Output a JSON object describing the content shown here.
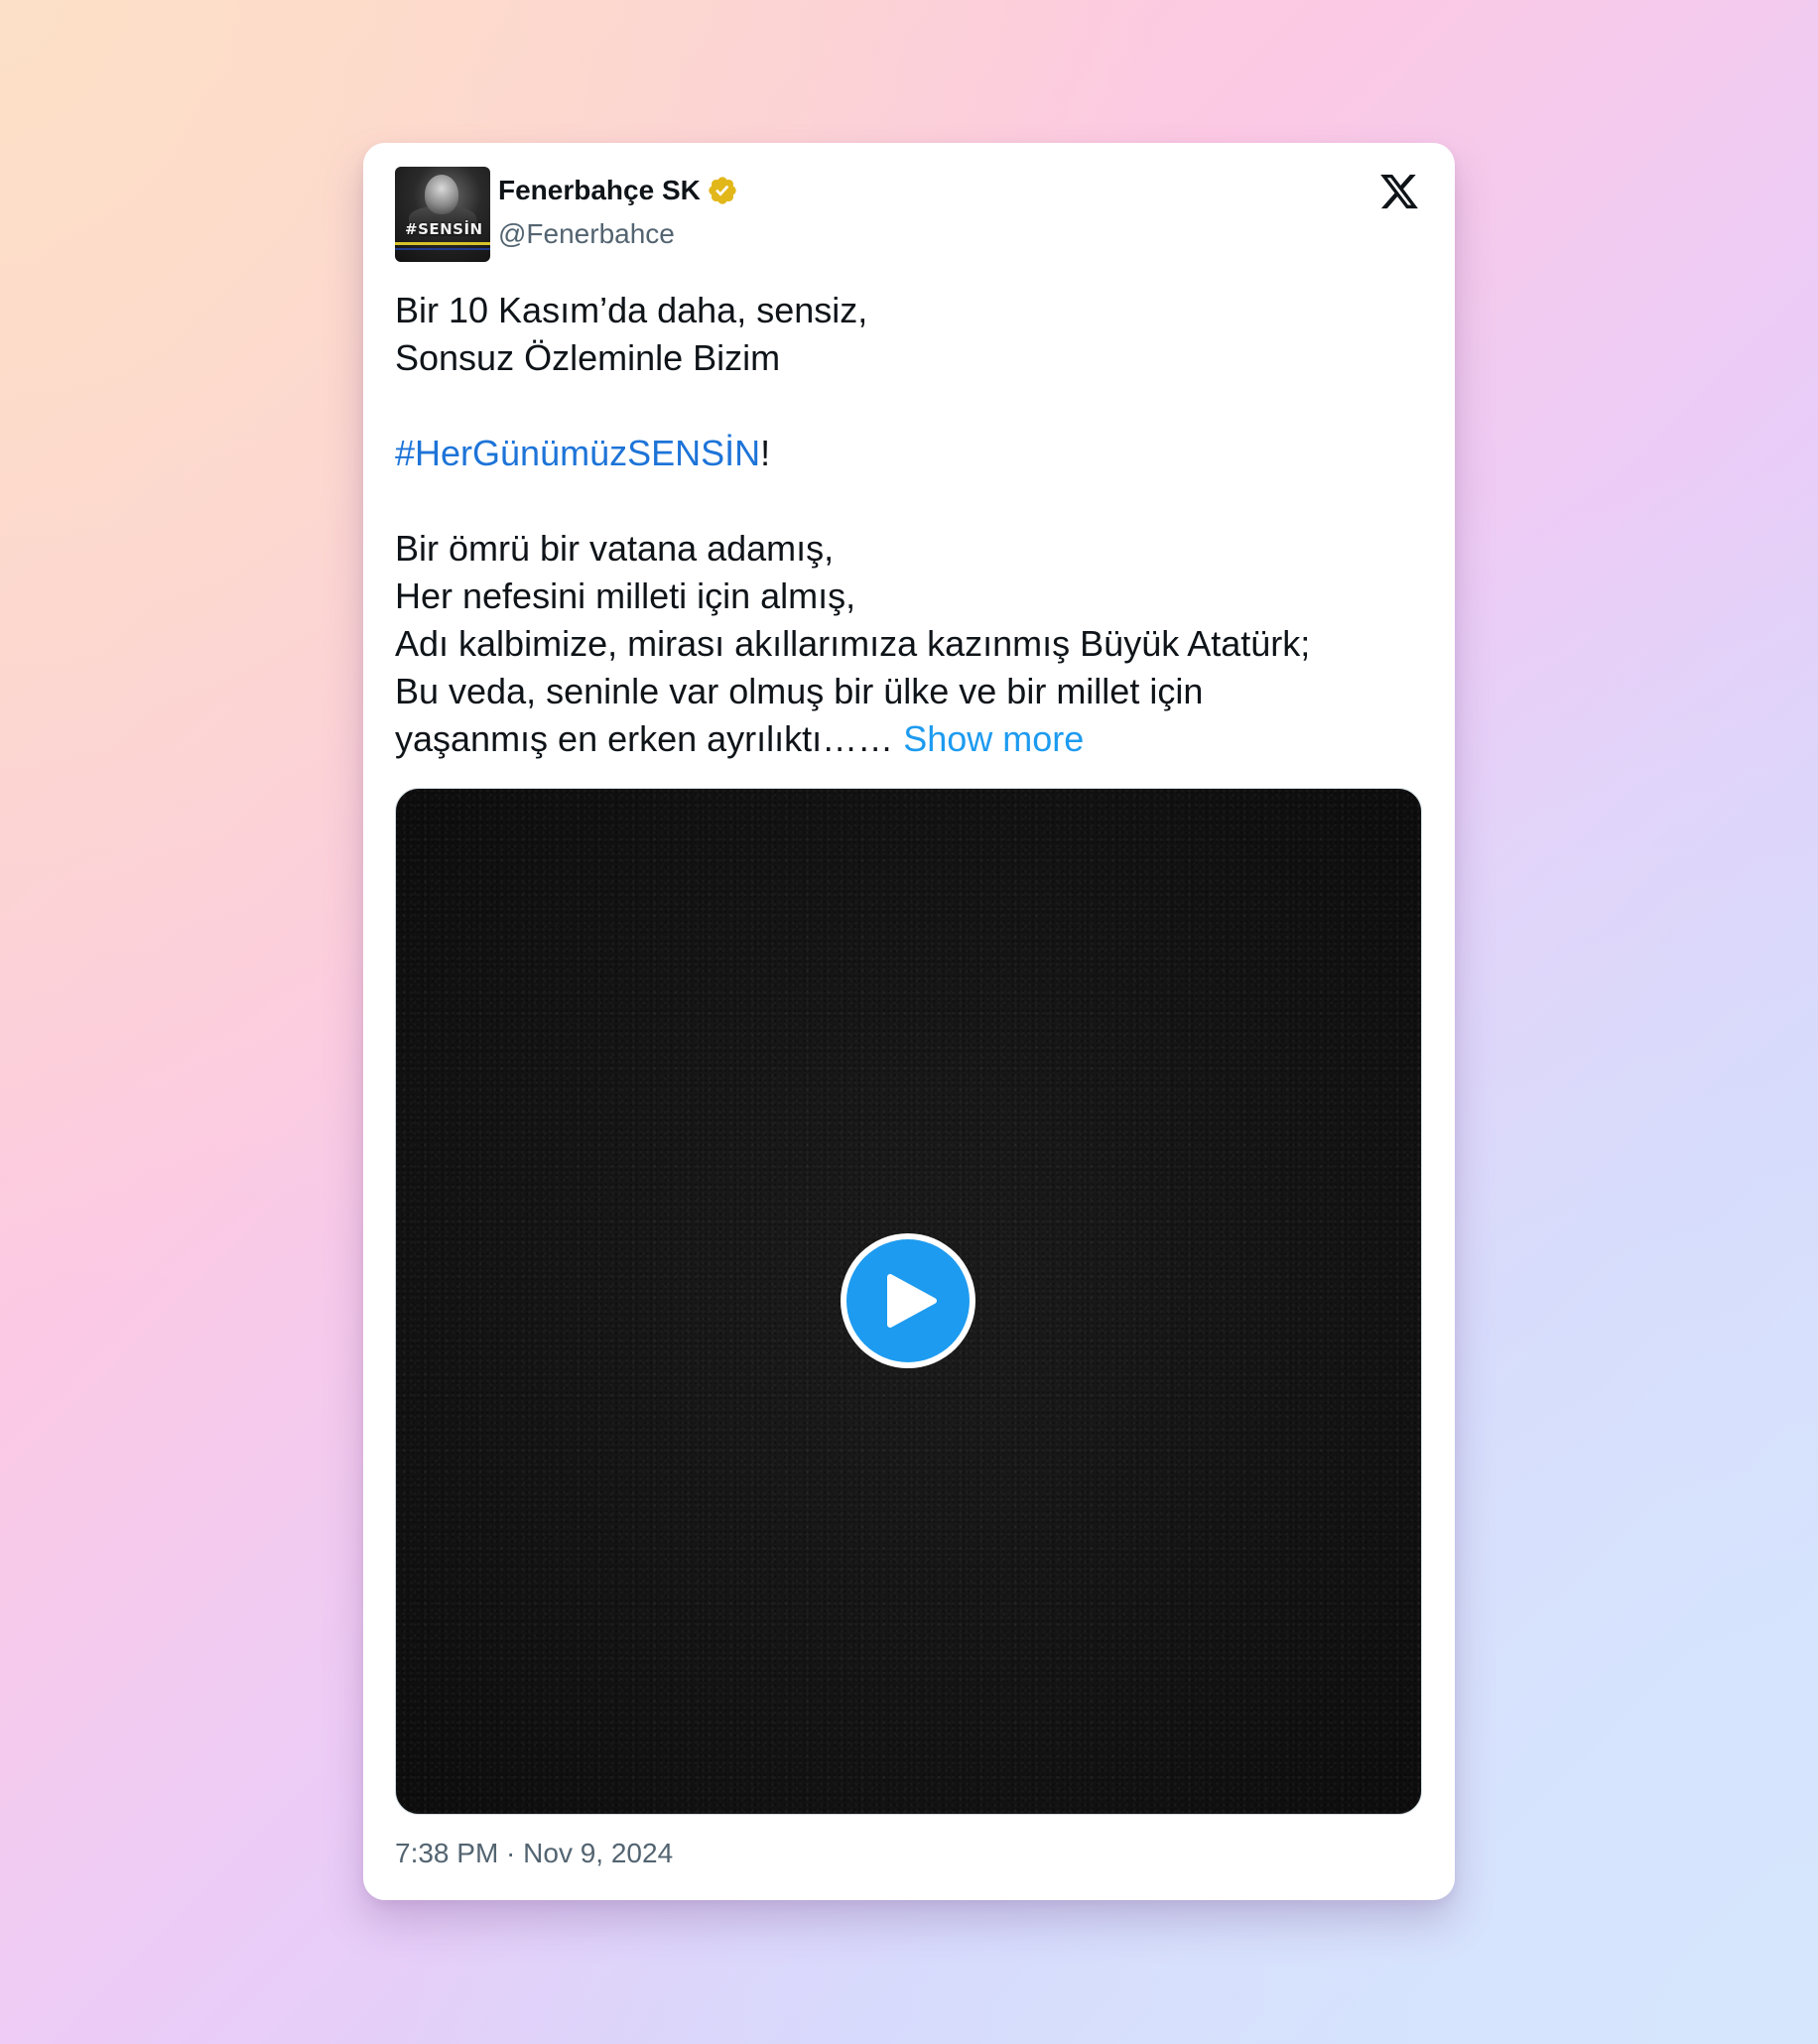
{
  "author": {
    "display_name": "Fenerbahçe SK",
    "handle": "@Fenerbahce",
    "verified": true,
    "verified_badge_color": "#e2b719",
    "avatar_text": "#SENSİN"
  },
  "platform_logo": "x-logo",
  "tweet": {
    "lines": [
      "Bir 10 Kasım’da daha, sensiz,",
      "Sonsuz Özleminle Bizim",
      "",
      "#HerGünümüzSENSİN",
      "!",
      "",
      "Bir ömrü bir vatana adamış,",
      "Her nefesini milleti için almış,",
      "Adı kalbimize, mirası akıllarımıza kazınmış Büyük Atatürk;",
      "Bu veda, seninle var olmuş bir ülke ve bir millet için",
      "yaşanmış en erken ayrılıktı……",
      "Show more"
    ]
  },
  "media": {
    "type": "video",
    "play_icon": "play-icon"
  },
  "timestamp": "7:38 PM · Nov 9, 2024",
  "colors": {
    "hashtag": "#1d74d8",
    "link": "#1d9bf0",
    "play_button": "#1d9bf0",
    "text": "#0f1419",
    "secondary_text": "#536471"
  }
}
